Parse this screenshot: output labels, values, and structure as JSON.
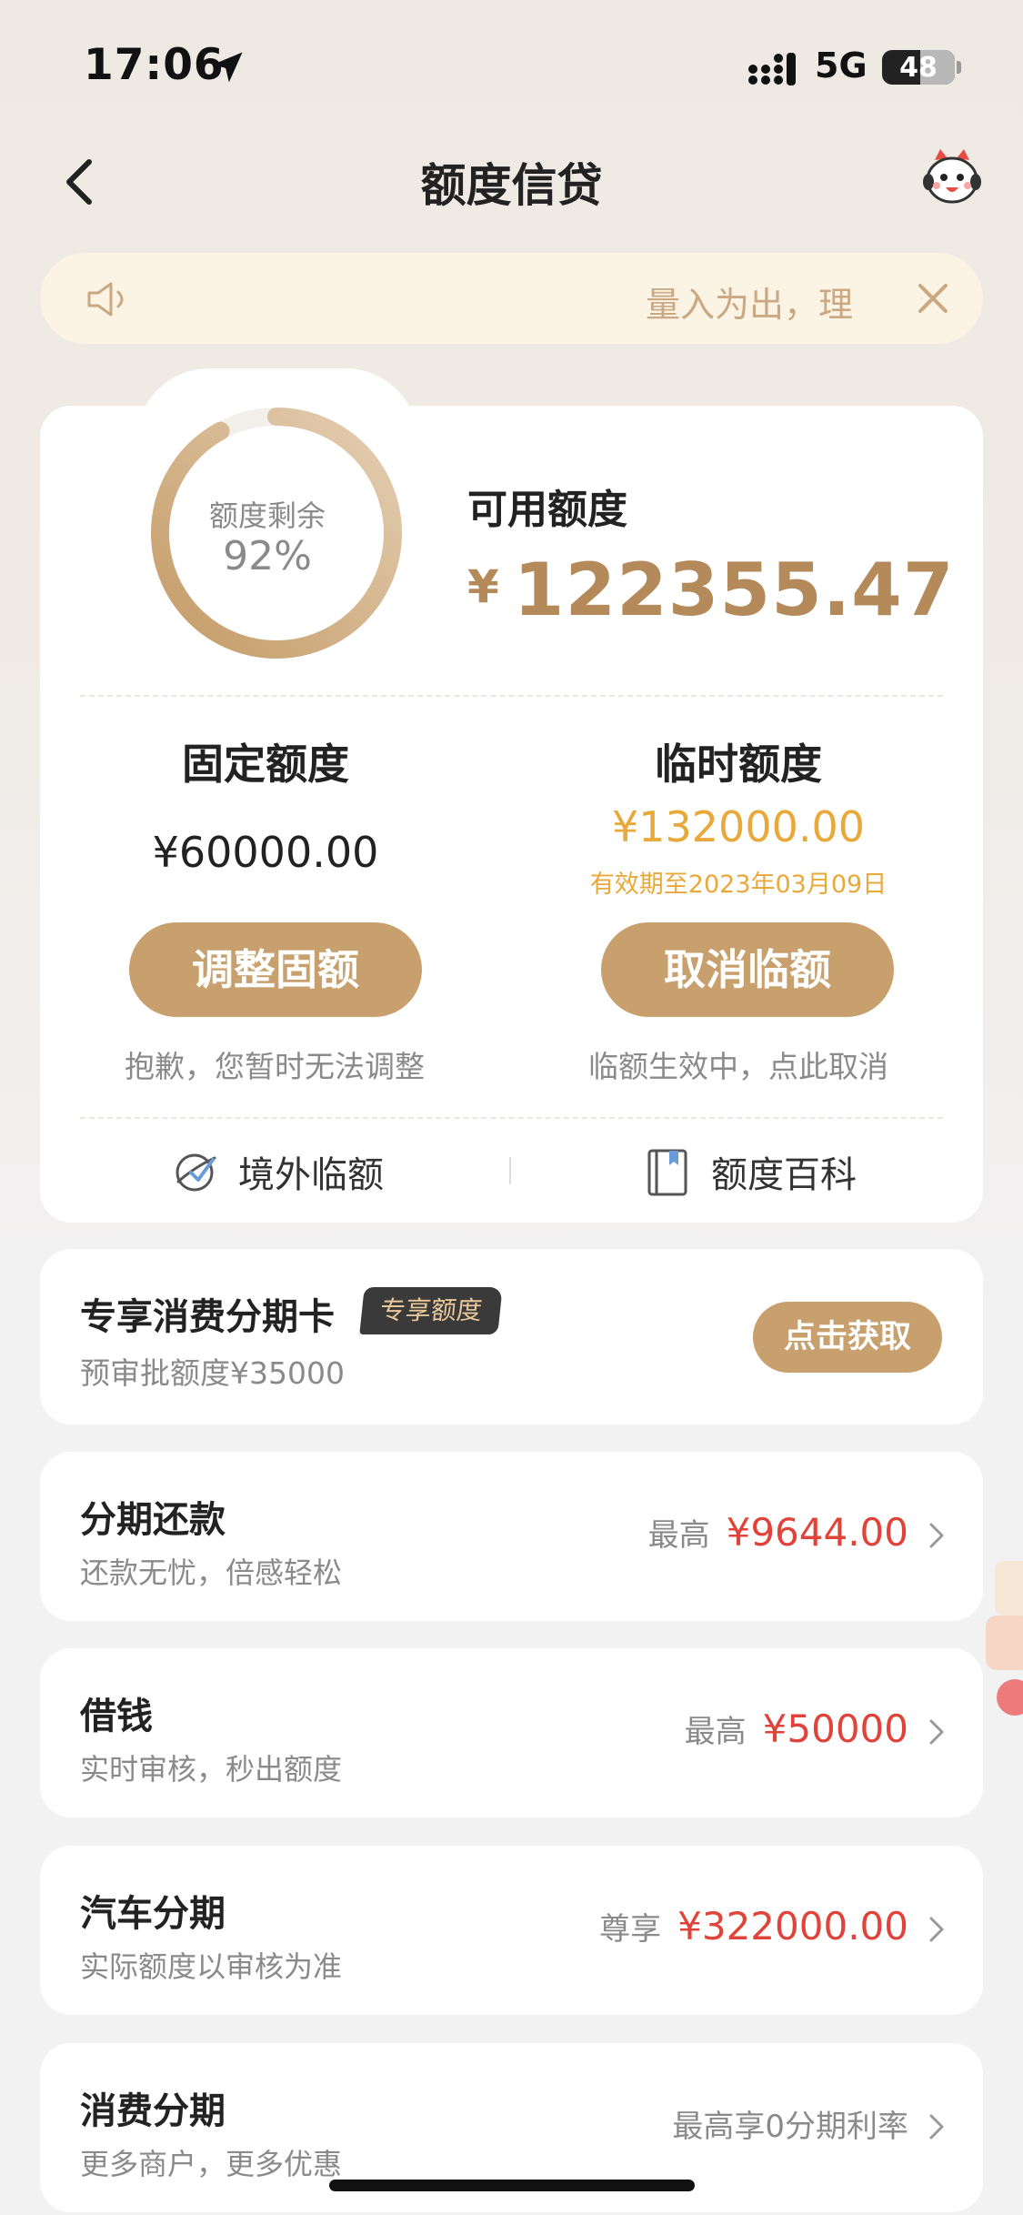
{
  "status_bar": {
    "time": "17:06",
    "network": "5G",
    "battery": "48"
  },
  "nav": {
    "title": "额度信贷"
  },
  "notice": {
    "text": "量入为出，理"
  },
  "credit": {
    "ring_label": "额度剩余",
    "ring_percent": "92%",
    "ring_fraction": 0.92,
    "available_label": "可用额度",
    "available_currency": "¥",
    "available_amount": "122355.47",
    "fixed": {
      "title": "固定额度",
      "amount": "¥60000.00",
      "button": "调整固额",
      "hint": "抱歉，您暂时无法调整"
    },
    "temporary": {
      "title": "临时额度",
      "amount": "¥132000.00",
      "expiry": "有效期至2023年03月09日",
      "button": "取消临额",
      "hint": "临额生效中，点此取消"
    },
    "links": [
      {
        "label": "境外临额",
        "icon": "globe-plane-icon"
      },
      {
        "label": "额度百科",
        "icon": "book-icon"
      }
    ]
  },
  "promo": {
    "title": "专享消费分期卡",
    "tag": "专享额度",
    "subtitle": "预审批额度¥35000",
    "button": "点击获取"
  },
  "products": [
    {
      "title": "分期还款",
      "subtitle": "还款无忧，倍感轻松",
      "prefix": "最高",
      "amount": "¥9644.00"
    },
    {
      "title": "借钱",
      "subtitle": "实时审核，秒出额度",
      "prefix": "最高",
      "amount": "¥50000"
    },
    {
      "title": "汽车分期",
      "subtitle": "实际额度以审核为准",
      "prefix": "尊享",
      "amount": "¥322000.00"
    },
    {
      "title": "消费分期",
      "subtitle": "更多商户，更多优惠",
      "note": "最高享0分期利率"
    }
  ],
  "colors": {
    "gold": "#c8a06e",
    "amber": "#e9a93a",
    "red": "#e0433a",
    "text_gray": "#8a8a8a"
  }
}
